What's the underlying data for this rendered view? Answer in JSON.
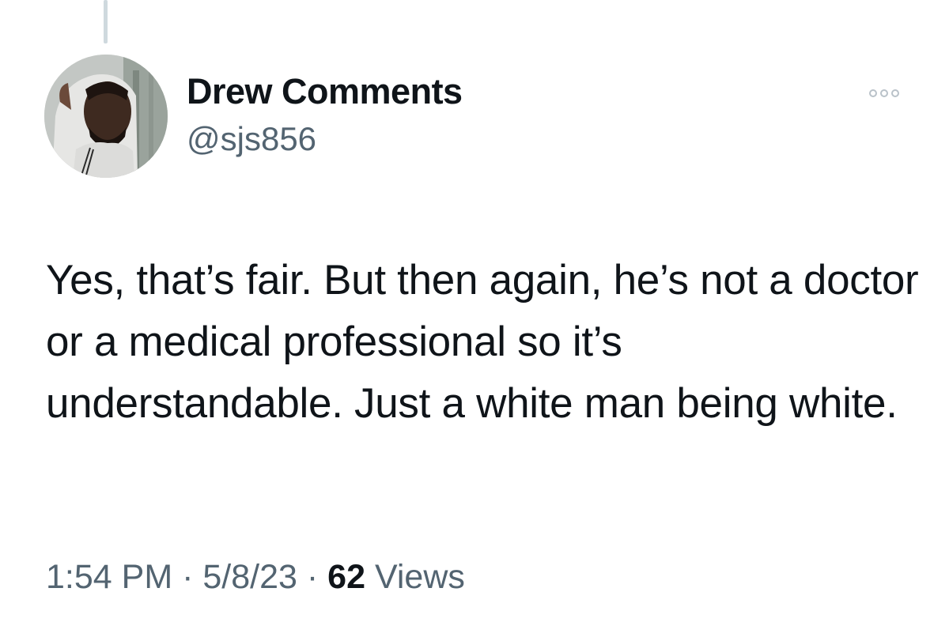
{
  "author": {
    "display_name": "Drew Comments",
    "handle": "@sjs856"
  },
  "tweet": {
    "text": "Yes, that’s fair. But then again, he’s not a doctor or a medical professional so it’s understandable. Just a white man being white."
  },
  "meta": {
    "time": "1:54 PM",
    "separator": "·",
    "date": "5/8/23",
    "views_count": "62",
    "views_label": "Views"
  },
  "icons": {
    "more": "more-horizontal-icon",
    "avatar": "avatar-photo"
  },
  "colors": {
    "primary_text": "#0f1419",
    "secondary_text": "#536471",
    "thread_line": "#cfd9de",
    "background": "#ffffff"
  }
}
